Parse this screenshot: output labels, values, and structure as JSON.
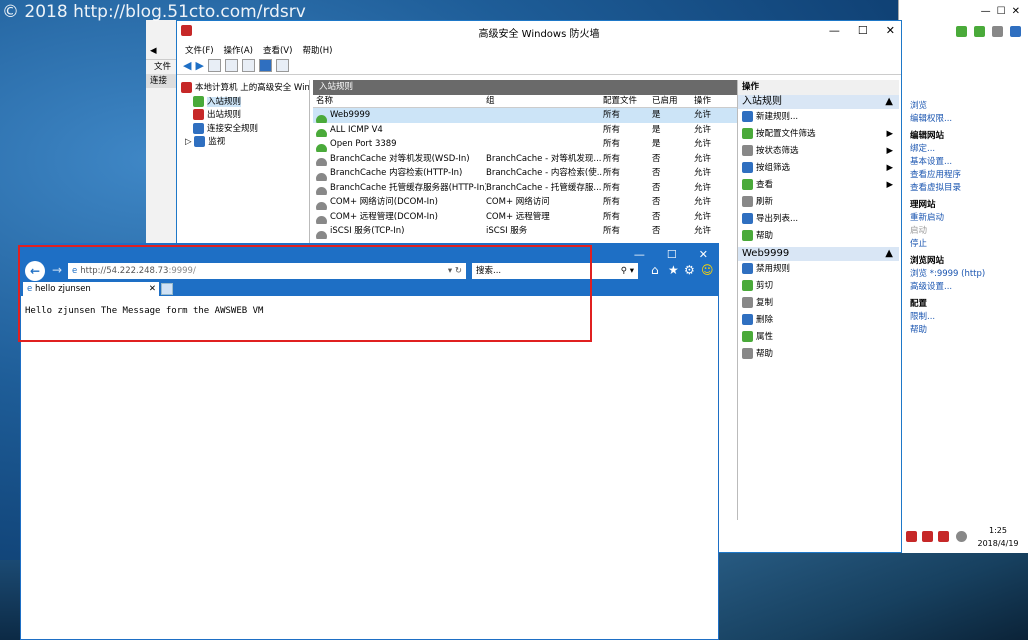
{
  "watermark": "© 2018 http://blog.51cto.com/rdsrv",
  "firewall": {
    "title": "高级安全 Windows 防火墙",
    "menu": [
      "文件(F)",
      "操作(A)",
      "查看(V)",
      "帮助(H)"
    ],
    "tree": [
      {
        "label": "本地计算机 上的高级安全 Win",
        "icon": "firewall-icon"
      },
      {
        "label": "入站规则",
        "icon": "inbound-rules-icon"
      },
      {
        "label": "出站规则",
        "icon": "outbound-rules-icon"
      },
      {
        "label": "连接安全规则",
        "icon": "connection-security-icon"
      },
      {
        "label": "监视",
        "icon": "monitor-icon"
      }
    ],
    "panel_title": "入站规则",
    "columns": [
      "名称",
      "组",
      "配置文件",
      "已启用",
      "操作"
    ],
    "rows": [
      {
        "name": "Web9999",
        "group": "",
        "profile": "所有",
        "enabled": "是",
        "action": "允许",
        "icon": "enabled-check-icon"
      },
      {
        "name": "ALL ICMP V4",
        "group": "",
        "profile": "所有",
        "enabled": "是",
        "action": "允许",
        "icon": "enabled-check-icon"
      },
      {
        "name": "Open Port 3389",
        "group": "",
        "profile": "所有",
        "enabled": "是",
        "action": "允许",
        "icon": "enabled-check-icon"
      },
      {
        "name": "BranchCache 对等机发现(WSD-In)",
        "group": "BranchCache - 对等机发现...",
        "profile": "所有",
        "enabled": "否",
        "action": "允许",
        "icon": "disabled-icon"
      },
      {
        "name": "BranchCache 内容检索(HTTP-In)",
        "group": "BranchCache - 内容检索(使...",
        "profile": "所有",
        "enabled": "否",
        "action": "允许",
        "icon": "disabled-icon"
      },
      {
        "name": "BranchCache 托管缓存服务器(HTTP-In)",
        "group": "BranchCache - 托管缓存服...",
        "profile": "所有",
        "enabled": "否",
        "action": "允许",
        "icon": "disabled-icon"
      },
      {
        "name": "COM+ 网络访问(DCOM-In)",
        "group": "COM+ 网络访问",
        "profile": "所有",
        "enabled": "否",
        "action": "允许",
        "icon": "disabled-icon"
      },
      {
        "name": "COM+ 远程管理(DCOM-In)",
        "group": "COM+ 远程管理",
        "profile": "所有",
        "enabled": "否",
        "action": "允许",
        "icon": "disabled-icon"
      },
      {
        "name": "iSCSI 服务(TCP-In)",
        "group": "iSCSI 服务",
        "profile": "所有",
        "enabled": "否",
        "action": "允许",
        "icon": "disabled-icon"
      }
    ],
    "actions_header": "操作",
    "section1": {
      "title": "入站规则",
      "items": [
        "新建规则...",
        "按配置文件筛选",
        "按状态筛选",
        "按组筛选",
        "查看",
        "刷新",
        "导出列表...",
        "帮助"
      ]
    },
    "section2": {
      "title": "Web9999",
      "items": [
        "禁用规则",
        "剪切",
        "复制",
        "删除",
        "属性",
        "帮助"
      ]
    }
  },
  "browser": {
    "url_host": "http://54.222.248.73",
    "url_port": ":9999/",
    "search_placeholder": "搜索...",
    "tab_title": "hello zjunsen",
    "content": "Hello zjunsen The Message form the AWSWEB VM"
  },
  "behind_left": {
    "labels": [
      "文件",
      "连接"
    ]
  },
  "iis": {
    "items": [
      {
        "t": "浏览",
        "k": "lnk"
      },
      {
        "t": "编辑权限...",
        "k": "lnk"
      },
      {
        "t": "编辑网站",
        "k": "hd"
      },
      {
        "t": "绑定...",
        "k": "lnk"
      },
      {
        "t": "基本设置...",
        "k": "lnk"
      },
      {
        "t": "查看应用程序",
        "k": "lnk"
      },
      {
        "t": "查看虚拟目录",
        "k": "lnk"
      },
      {
        "t": "理网站",
        "k": "hd"
      },
      {
        "t": "重新启动",
        "k": "lnk"
      },
      {
        "t": "启动",
        "k": "dim"
      },
      {
        "t": "停止",
        "k": "lnk"
      },
      {
        "t": "浏览网站",
        "k": "hd"
      },
      {
        "t": "浏览 *:9999 (http)",
        "k": "lnk"
      },
      {
        "t": "高级设置...",
        "k": "lnk"
      },
      {
        "t": "配置",
        "k": "hd"
      },
      {
        "t": "限制...",
        "k": "lnk"
      },
      {
        "t": "帮助",
        "k": "lnk"
      }
    ]
  },
  "taskbar": {
    "time": "1:25",
    "date": "2018/4/19"
  }
}
